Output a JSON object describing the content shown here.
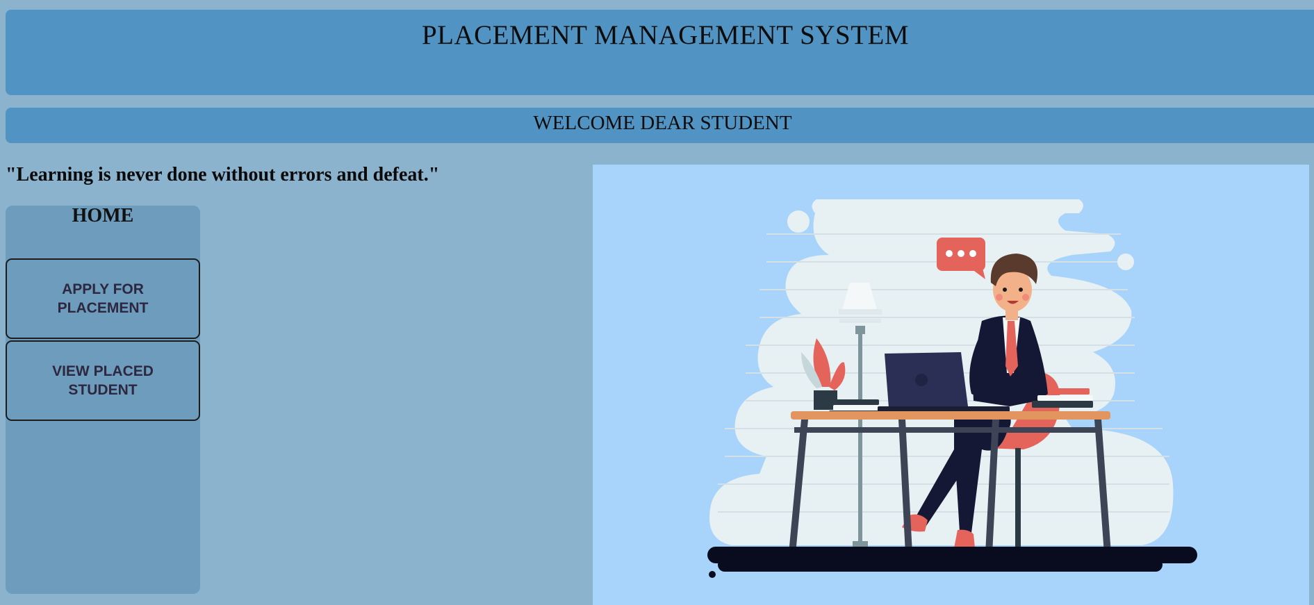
{
  "header": {
    "title": "PLACEMENT MANAGEMENT SYSTEM"
  },
  "welcome": {
    "text": "WELCOME DEAR STUDENT"
  },
  "quote": "\"Learning is never done without errors and defeat.\"",
  "sidebar": {
    "home_label": "HOME",
    "items": [
      {
        "label": "APPLY FOR PLACEMENT"
      },
      {
        "label": "VIEW PLACED STUDENT"
      }
    ]
  },
  "illustration": {
    "name": "student-at-desk-illustration"
  },
  "colors": {
    "background": "#8bb3cd",
    "header_bar": "#5194c3",
    "sidebar": "#6d9cbc",
    "illustration_bg": "#a8d4fb"
  }
}
